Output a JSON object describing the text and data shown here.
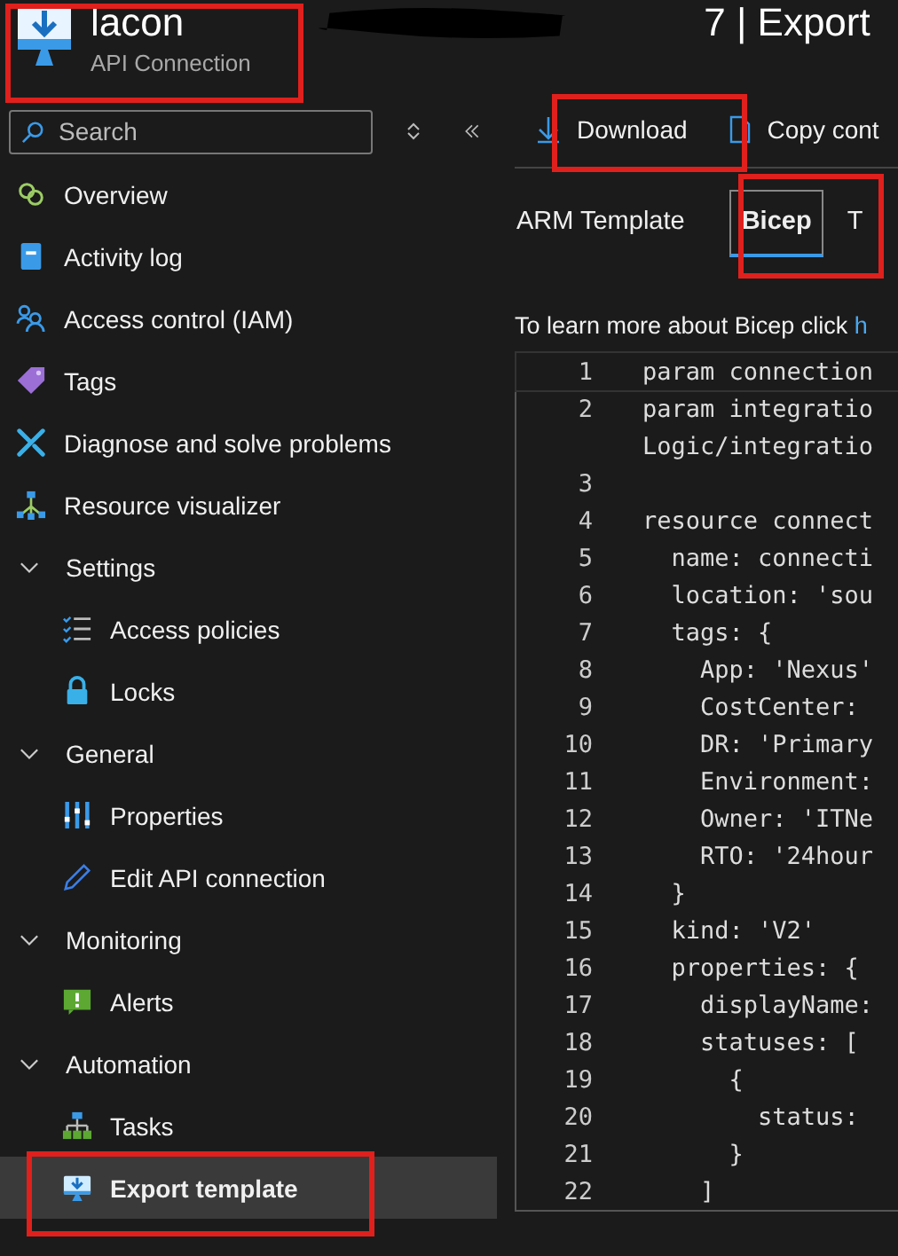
{
  "header": {
    "title_start": "lacon",
    "title_end": "7 | Export",
    "subtitle": "API Connection"
  },
  "sidebar": {
    "search": {
      "placeholder": "Search"
    },
    "items": [
      {
        "kind": "item",
        "label": "Overview",
        "selected": false
      },
      {
        "kind": "item",
        "label": "Activity log",
        "selected": false
      },
      {
        "kind": "item",
        "label": "Access control (IAM)",
        "selected": false
      },
      {
        "kind": "item",
        "label": "Tags",
        "selected": false
      },
      {
        "kind": "item",
        "label": "Diagnose and solve problems",
        "selected": false
      },
      {
        "kind": "item",
        "label": "Resource visualizer",
        "selected": false
      },
      {
        "kind": "group",
        "label": "Settings",
        "expanded": true,
        "children": [
          {
            "label": "Access policies",
            "selected": false
          },
          {
            "label": "Locks",
            "selected": false
          }
        ]
      },
      {
        "kind": "group",
        "label": "General",
        "expanded": true,
        "children": [
          {
            "label": "Properties",
            "selected": false
          },
          {
            "label": "Edit API connection",
            "selected": false
          }
        ]
      },
      {
        "kind": "group",
        "label": "Monitoring",
        "expanded": true,
        "children": [
          {
            "label": "Alerts",
            "selected": false
          }
        ]
      },
      {
        "kind": "group",
        "label": "Automation",
        "expanded": true,
        "children": [
          {
            "label": "Tasks",
            "selected": false
          },
          {
            "label": "Export template",
            "selected": true
          }
        ]
      }
    ]
  },
  "toolbar": {
    "buttons": [
      "Download",
      "Copy cont"
    ]
  },
  "tabs": [
    {
      "label": "ARM Template",
      "selected": false
    },
    {
      "label": "Bicep",
      "selected": true
    },
    {
      "label": "T",
      "selected": false
    }
  ],
  "info": {
    "text": "To learn more about Bicep click",
    "link": "h"
  },
  "code": [
    {
      "number": "1",
      "text": "param connection"
    },
    {
      "number": "2",
      "text": "param integratio",
      "wrap": "Logic/integratio"
    },
    {
      "number": "3"
    },
    {
      "number": "4",
      "text": "resource connect"
    },
    {
      "number": "5",
      "text": "  name: connecti"
    },
    {
      "number": "6",
      "text": "  location: 'sou"
    },
    {
      "number": "7",
      "text": "  tags: {"
    },
    {
      "number": "8",
      "text": "    App: 'Nexus'"
    },
    {
      "number": "9",
      "text": "    CostCenter:"
    },
    {
      "number": "10",
      "text": "    DR: 'Primary"
    },
    {
      "number": "11",
      "text": "    Environment:"
    },
    {
      "number": "12",
      "text": "    Owner: 'ITNe"
    },
    {
      "number": "13",
      "text": "    RTO: '24hour"
    },
    {
      "number": "14",
      "text": "  }"
    },
    {
      "number": "15",
      "text": "  kind: 'V2'"
    },
    {
      "number": "16",
      "text": "  properties: {"
    },
    {
      "number": "17",
      "text": "    displayName:"
    },
    {
      "number": "18",
      "text": "    statuses: ["
    },
    {
      "number": "19",
      "text": "      {"
    },
    {
      "number": "20",
      "text": "        status:"
    },
    {
      "number": "21",
      "text": "      }"
    },
    {
      "number": "22",
      "text": "    ]"
    }
  ]
}
